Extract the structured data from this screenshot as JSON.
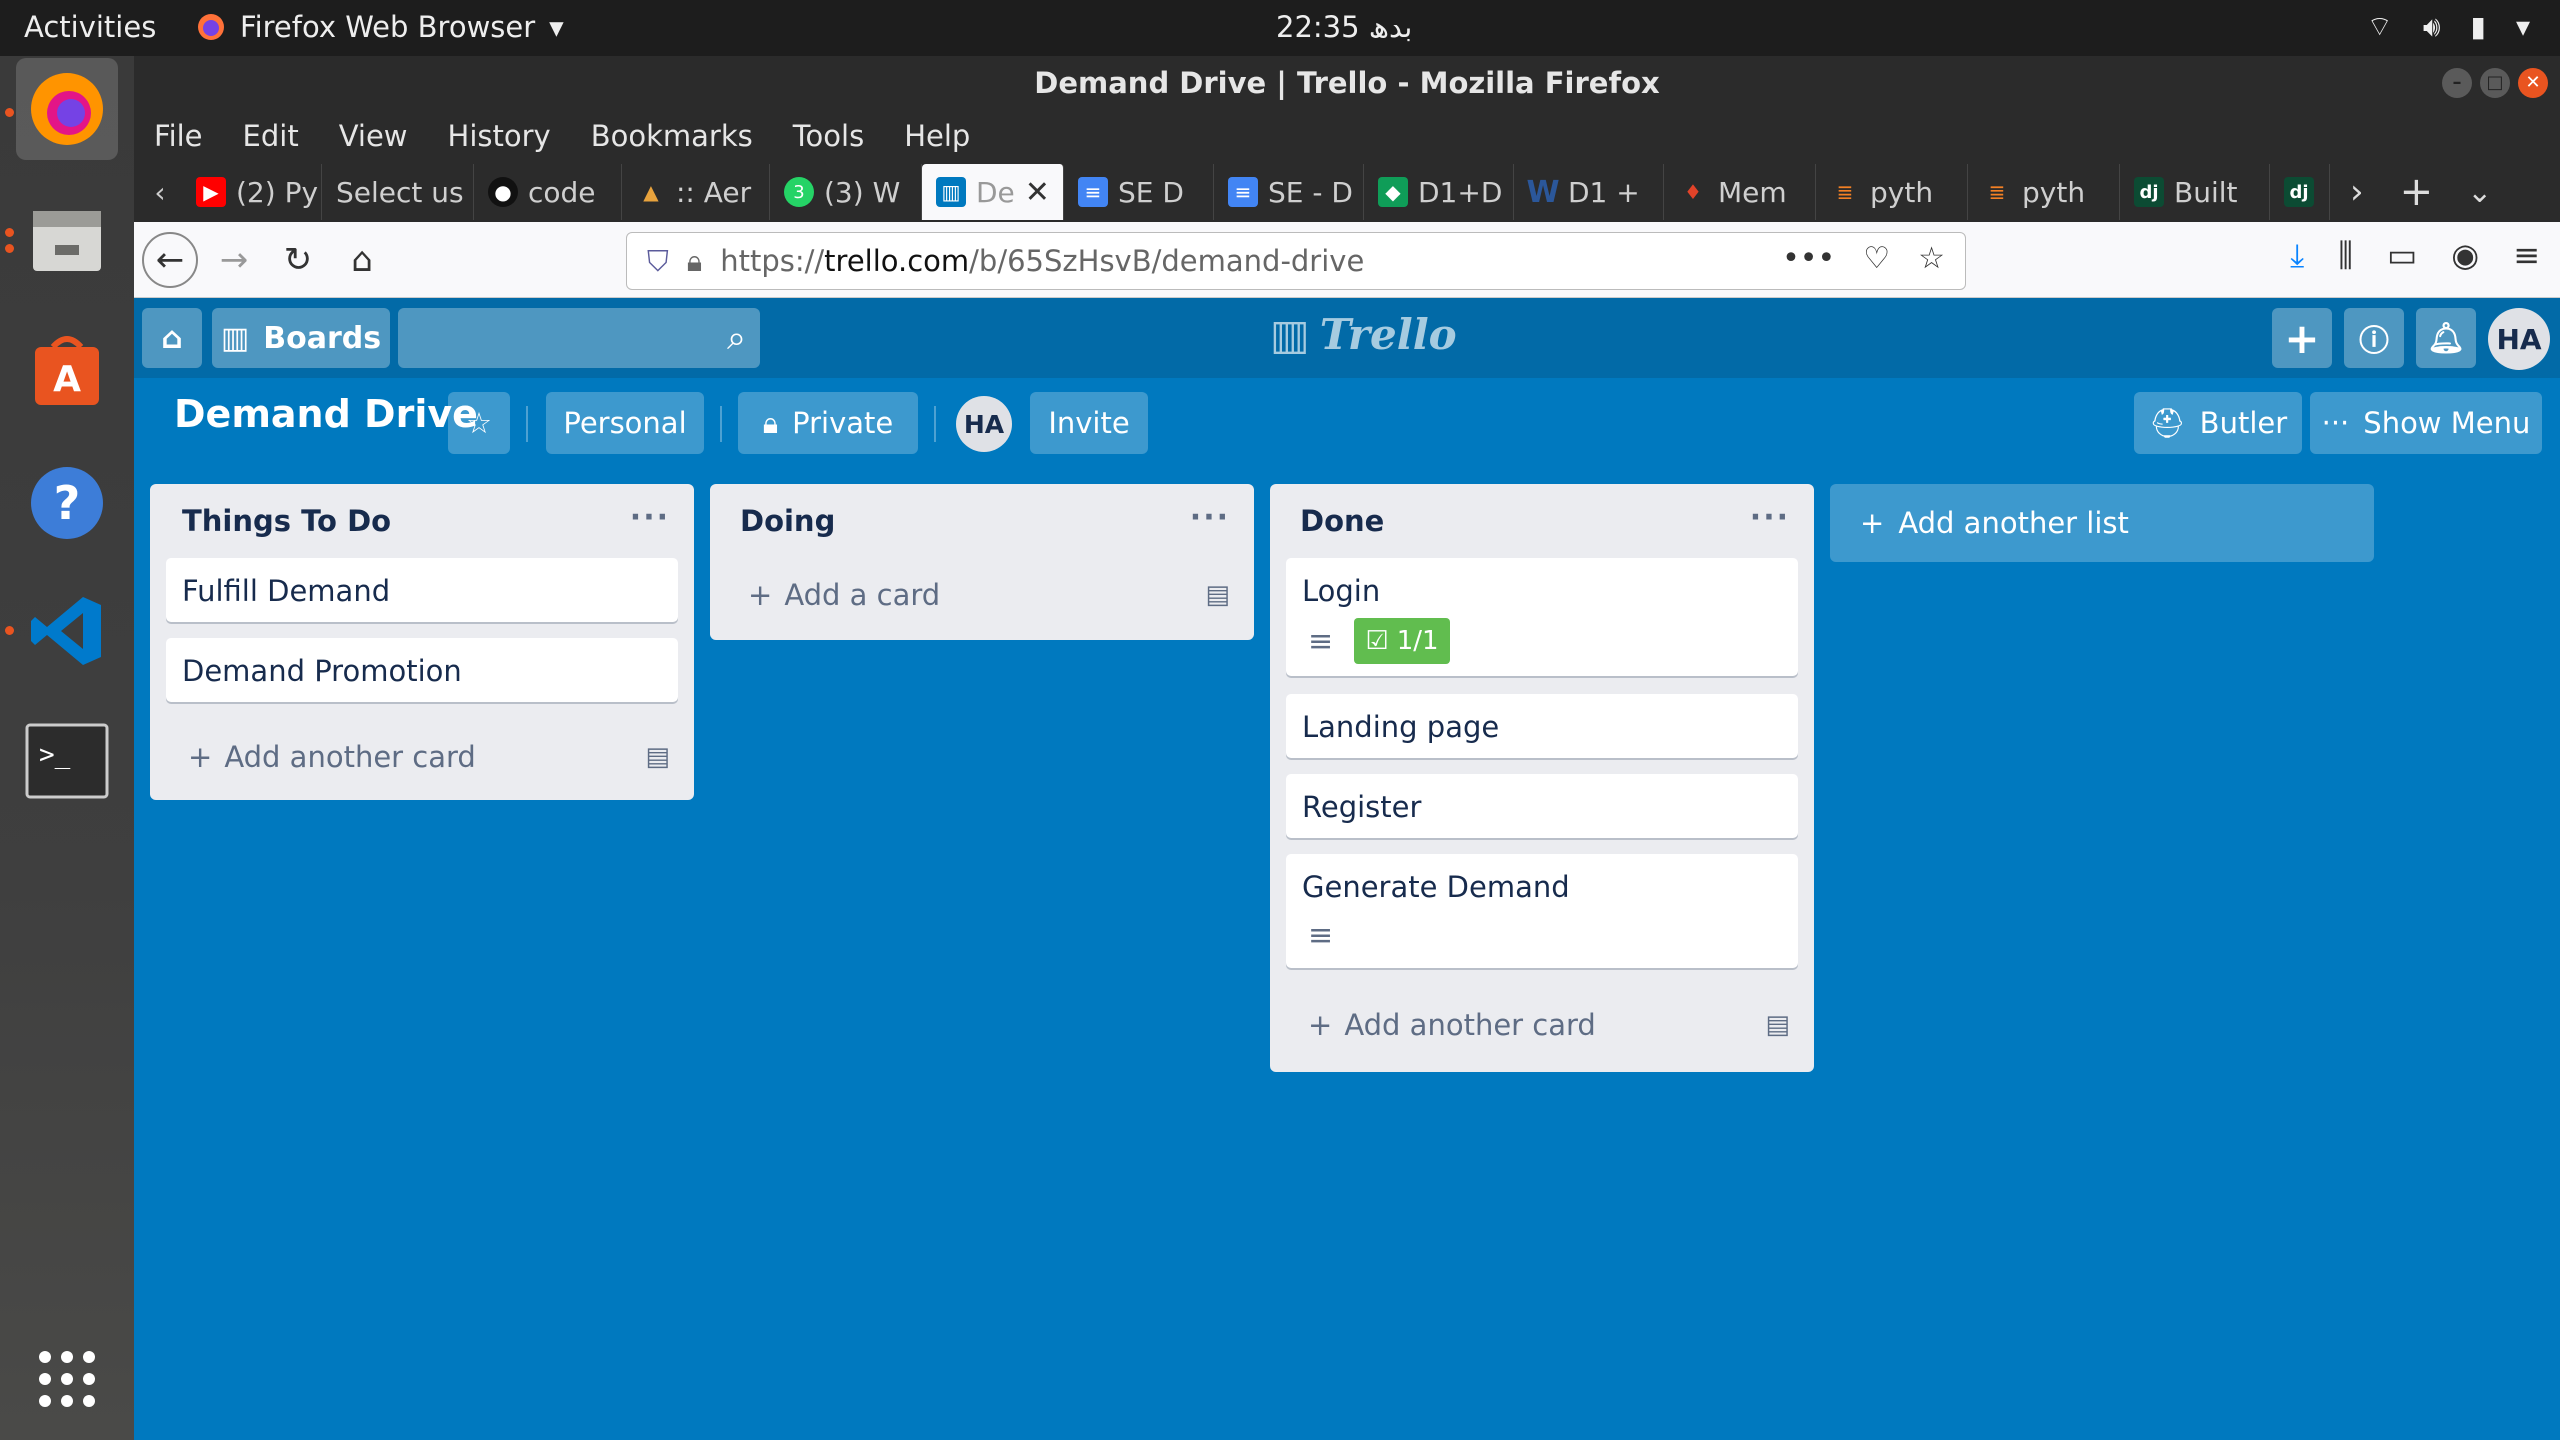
{
  "topbar": {
    "activities": "Activities",
    "app_name": "Firefox Web Browser",
    "clock": "22:35 بدھ"
  },
  "window": {
    "title": "Demand Drive | Trello - Mozilla Firefox"
  },
  "menu": [
    "File",
    "Edit",
    "View",
    "History",
    "Bookmarks",
    "Tools",
    "Help"
  ],
  "tabs": [
    {
      "label": "(2) Py",
      "icon": "youtube-icon",
      "color": "#ff0000"
    },
    {
      "label": "Select us",
      "icon": "none",
      "color": ""
    },
    {
      "label": "code",
      "icon": "github-icon",
      "color": "#111111"
    },
    {
      "label": ":: Aer",
      "icon": "aer-icon",
      "color": "#e8a33d"
    },
    {
      "label": "(3) W",
      "icon": "whatsapp-icon",
      "color": "#25d366"
    },
    {
      "label": "De",
      "icon": "trello-icon",
      "color": "#0079bf"
    },
    {
      "label": "SE D",
      "icon": "docs-icon",
      "color": "#4285f4"
    },
    {
      "label": "SE - D",
      "icon": "docs-icon",
      "color": "#4285f4"
    },
    {
      "label": "D1+D",
      "icon": "classroom-icon",
      "color": "#0f9d58"
    },
    {
      "label": "D1 +",
      "icon": "word-icon",
      "color": "#2b579a"
    },
    {
      "label": "Mem",
      "icon": "gitlab-icon",
      "color": "#e24329"
    },
    {
      "label": "pyth",
      "icon": "stackoverflow-icon",
      "color": "#f48024"
    },
    {
      "label": "pyth",
      "icon": "stackoverflow-icon",
      "color": "#f48024"
    },
    {
      "label": "Built",
      "icon": "django-icon",
      "color": "#0c4b33"
    },
    {
      "label": "",
      "icon": "django-icon",
      "color": "#0c4b33"
    }
  ],
  "url": {
    "prefix": "https://",
    "host": "trello.com",
    "path": "/b/65SzHsvB/demand-drive"
  },
  "trello": {
    "boards_label": "Boards",
    "logo_text": "Trello",
    "user_initials": "HA"
  },
  "board": {
    "title": "Demand Drive",
    "personal_label": "Personal",
    "private_label": "Private",
    "invite_label": "Invite",
    "butler_label": "Butler",
    "show_menu_label": "Show Menu",
    "add_list_label": "Add another list"
  },
  "lists": [
    {
      "title": "Things To Do",
      "cards": [
        "Fulfill Demand",
        "Demand Promotion"
      ],
      "add_label": "Add another card"
    },
    {
      "title": "Doing",
      "cards": [],
      "add_label": "Add a card"
    },
    {
      "title": "Done",
      "cards": [
        "Login",
        "Landing page",
        "Register",
        "Generate Demand"
      ],
      "checklist": "1/1",
      "add_label": "Add another card"
    }
  ],
  "colors": {
    "board_bg": "#0079bf",
    "header_bg": "#026aa7",
    "list_bg": "#ebecf0",
    "checklist_green": "#61bd4f",
    "ubuntu_orange": "#e95420"
  }
}
